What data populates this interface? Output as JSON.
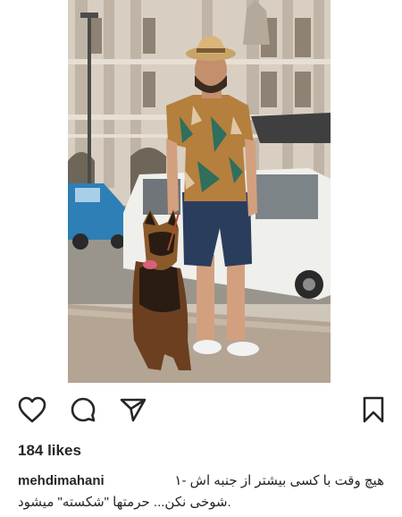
{
  "post": {
    "image_description_icon": "photo",
    "actions": {
      "like_icon": "heart-outline-icon",
      "comment_icon": "comment-bubble-icon",
      "share_icon": "paper-plane-icon",
      "save_icon": "bookmark-icon"
    },
    "likes_text": "184 likes",
    "caption": {
      "username": "mehdimahani",
      "line1": "هیچ وقت با کسی بیشتر از جنبه اش -۱",
      "line2": ".شوخی نکن... حرمتها \"شکسته\" میشود"
    }
  },
  "colors": {
    "text": "#262626",
    "icon_stroke": "#262626",
    "background": "#ffffff"
  }
}
